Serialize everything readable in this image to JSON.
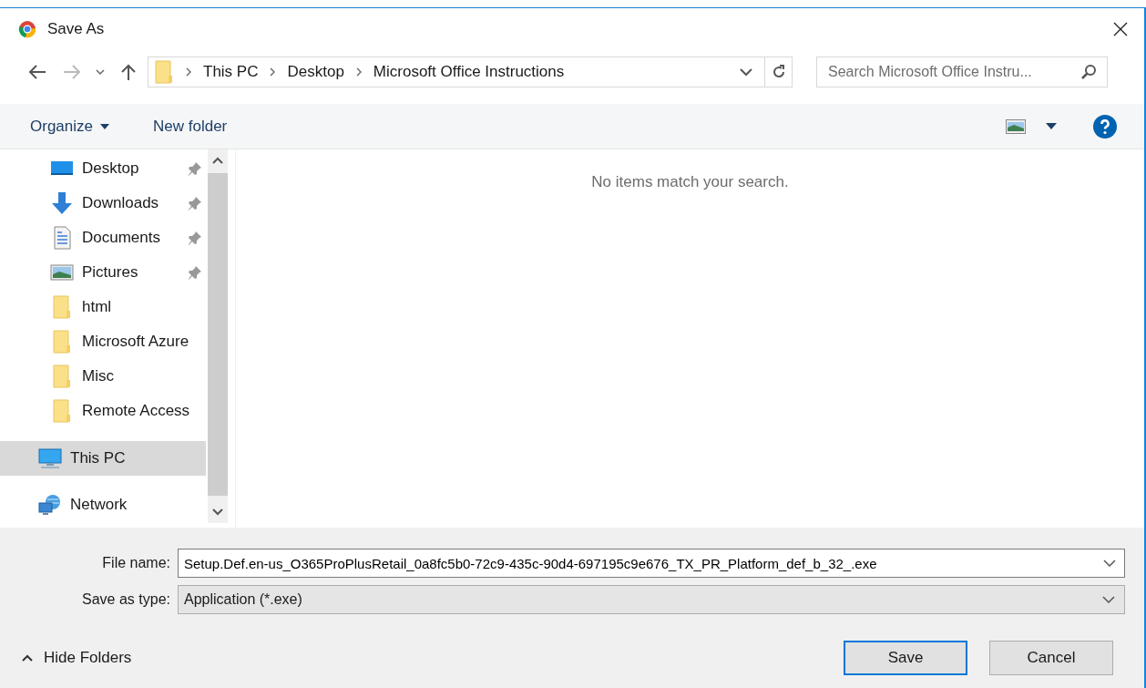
{
  "window": {
    "title": "Save As"
  },
  "address_bar": {
    "path": [
      "This PC",
      "Desktop",
      "Microsoft Office Instructions"
    ]
  },
  "search": {
    "placeholder": "Search Microsoft Office Instru..."
  },
  "toolbar": {
    "organize": "Organize",
    "new_folder": "New folder"
  },
  "sidebar": {
    "quick_access": [
      {
        "label": "Desktop",
        "kind": "desktop",
        "pinned": true,
        "selected": false
      },
      {
        "label": "Downloads",
        "kind": "downloads",
        "pinned": true,
        "selected": false
      },
      {
        "label": "Documents",
        "kind": "documents",
        "pinned": true,
        "selected": false
      },
      {
        "label": "Pictures",
        "kind": "pictures",
        "pinned": true,
        "selected": false
      },
      {
        "label": "html",
        "kind": "folder",
        "pinned": false,
        "selected": false
      },
      {
        "label": "Microsoft Azure",
        "kind": "folder",
        "pinned": false,
        "selected": false
      },
      {
        "label": "Misc",
        "kind": "folder",
        "pinned": false,
        "selected": false
      },
      {
        "label": "Remote Access",
        "kind": "folder",
        "pinned": false,
        "selected": false
      }
    ],
    "locations": [
      {
        "label": "This PC",
        "kind": "pc",
        "selected": true
      },
      {
        "label": "Network",
        "kind": "network",
        "selected": false
      }
    ]
  },
  "content": {
    "empty_message": "No items match your search."
  },
  "file_name": {
    "label": "File name:",
    "value": "Setup.Def.en-us_O365ProPlusRetail_0a8fc5b0-72c9-435c-90d4-697195c9e676_TX_PR_Platform_def_b_32_.exe"
  },
  "save_as_type": {
    "label": "Save as type:",
    "value": "Application (*.exe)"
  },
  "hide_folders": "Hide Folders",
  "buttons": [
    {
      "label": "Save",
      "default": true
    },
    {
      "label": "Cancel",
      "default": false
    }
  ]
}
